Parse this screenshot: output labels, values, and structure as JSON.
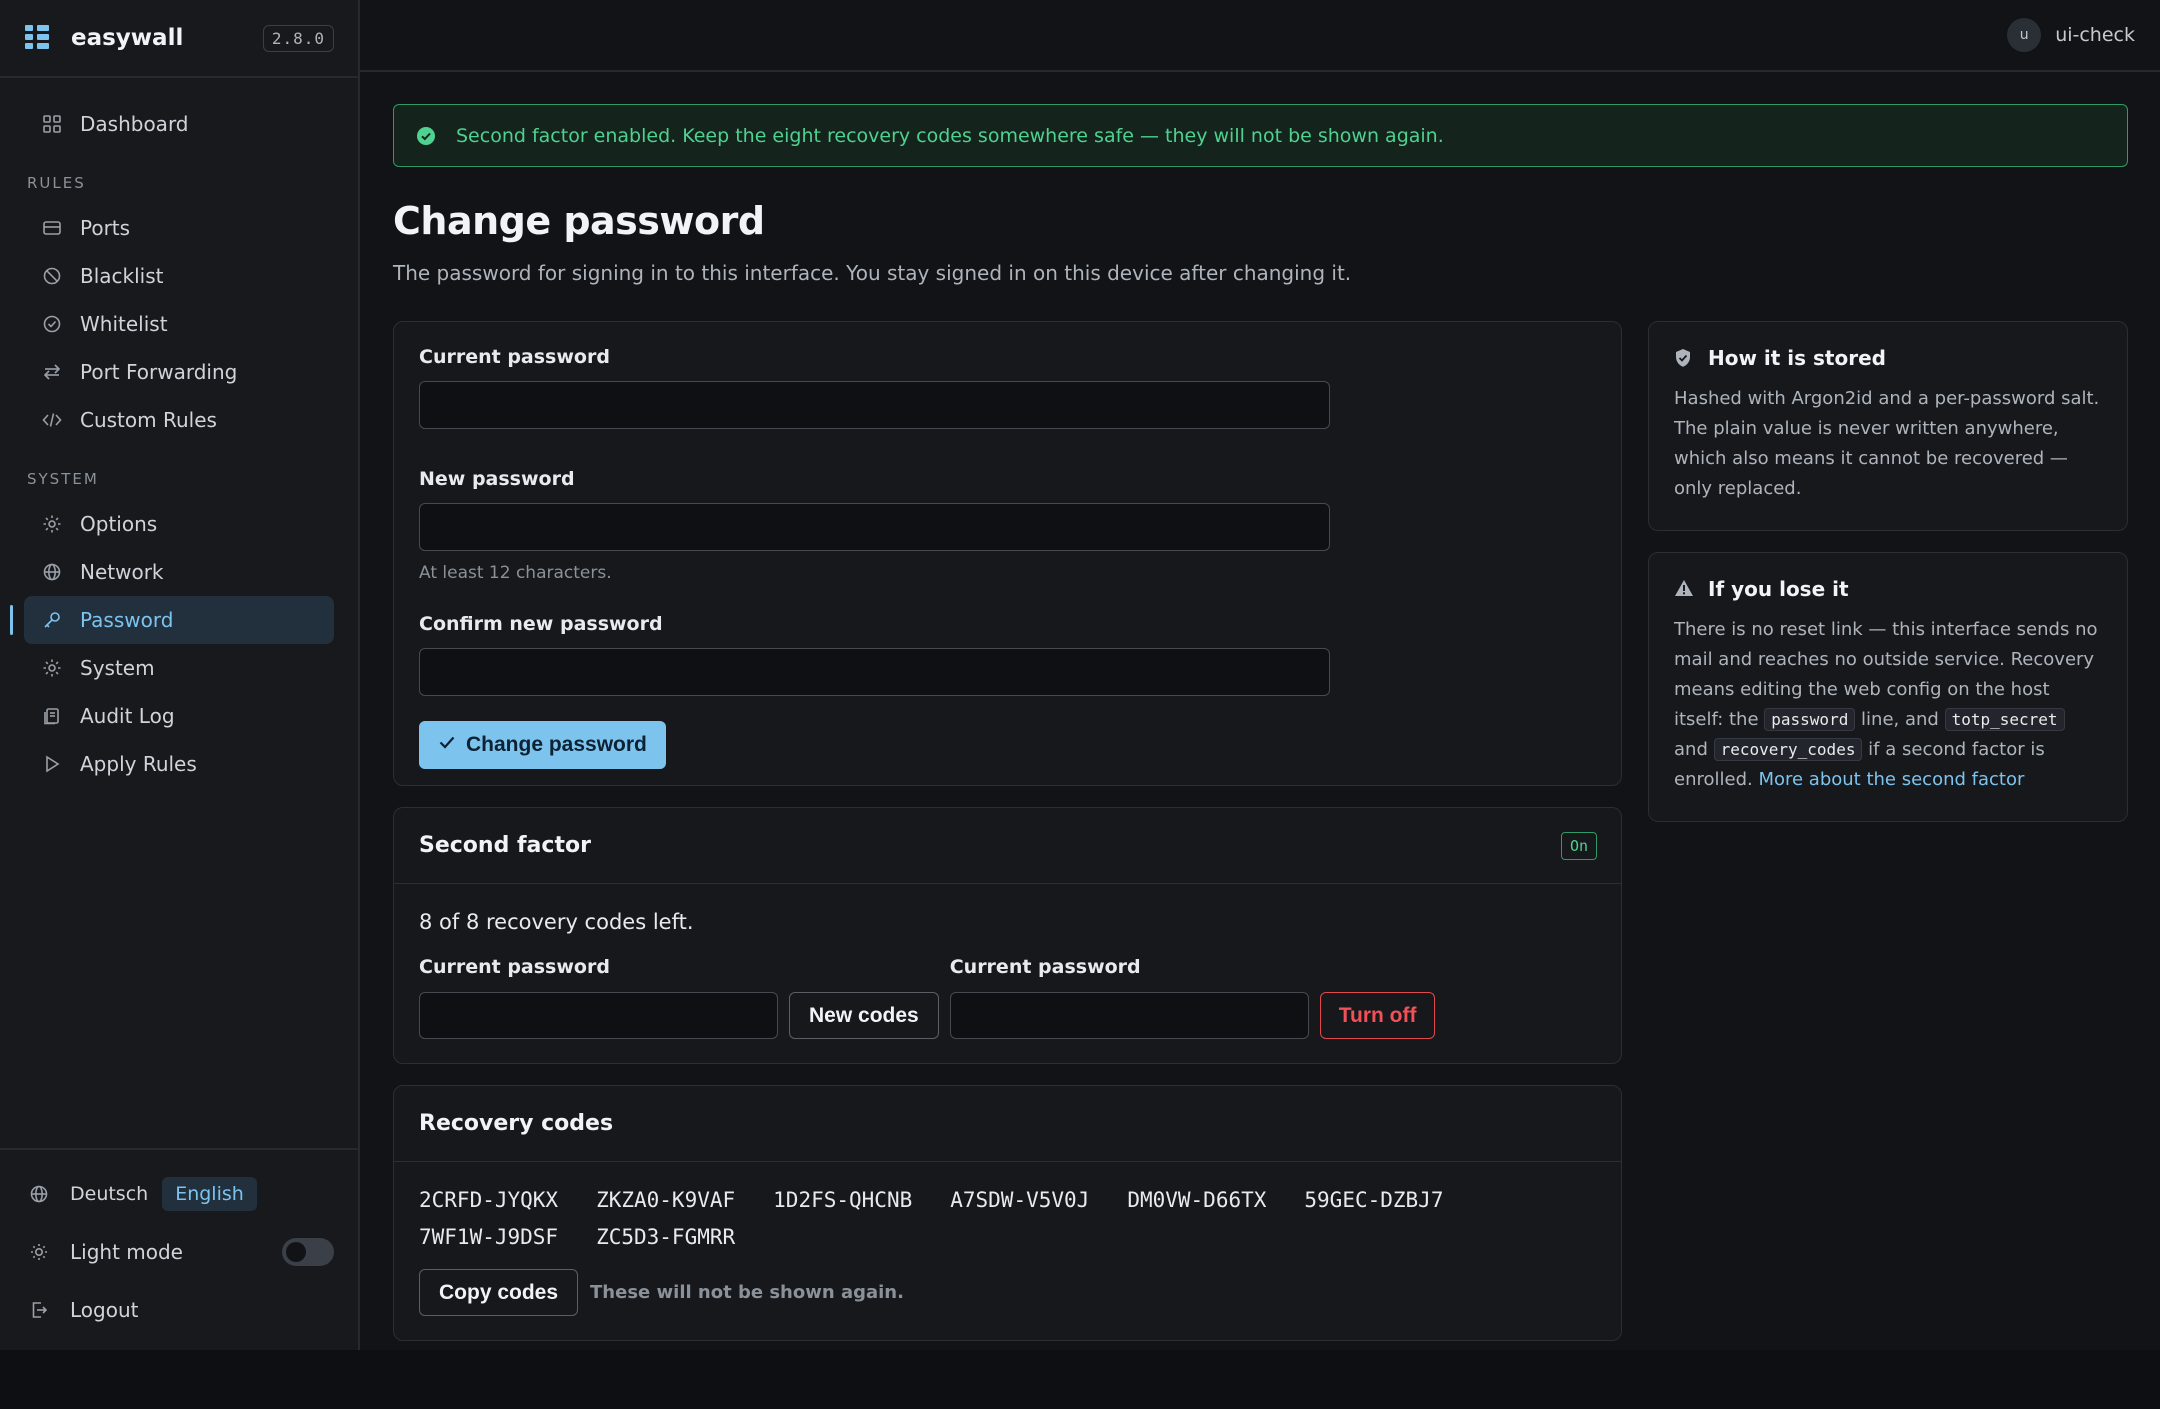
{
  "app": {
    "name": "easywall",
    "version": "2.8.0"
  },
  "sidebar": {
    "top_items": [
      {
        "label": "Dashboard",
        "icon": "grid-icon"
      }
    ],
    "sections": [
      {
        "title": "RULES",
        "items": [
          {
            "label": "Ports",
            "icon": "ports-icon"
          },
          {
            "label": "Blacklist",
            "icon": "ban-icon"
          },
          {
            "label": "Whitelist",
            "icon": "check-circle-icon"
          },
          {
            "label": "Port Forwarding",
            "icon": "arrows-icon"
          },
          {
            "label": "Custom Rules",
            "icon": "code-icon"
          }
        ]
      },
      {
        "title": "SYSTEM",
        "items": [
          {
            "label": "Options",
            "icon": "gear-icon"
          },
          {
            "label": "Network",
            "icon": "globe-icon"
          },
          {
            "label": "Password",
            "icon": "key-icon",
            "active": true
          },
          {
            "label": "System",
            "icon": "gear-icon"
          },
          {
            "label": "Audit Log",
            "icon": "log-icon"
          },
          {
            "label": "Apply Rules",
            "icon": "play-icon"
          }
        ]
      }
    ],
    "footer": {
      "languages": [
        "Deutsch",
        "English"
      ],
      "active_language": "English",
      "theme_label": "Light mode",
      "theme_on": false,
      "logout_label": "Logout"
    }
  },
  "topbar": {
    "avatar_initial": "u",
    "username": "ui-check"
  },
  "alert": {
    "text": "Second factor enabled. Keep the eight recovery codes somewhere safe — they will not be shown again.",
    "color": "#4fd18f"
  },
  "page": {
    "title": "Change password",
    "subtitle": "The password for signing in to this interface. You stay signed in on this device after changing it."
  },
  "password_form": {
    "current_label": "Current password",
    "current_value": "",
    "new_label": "New password",
    "new_value": "",
    "new_hint": "At least 12 characters.",
    "confirm_label": "Confirm new password",
    "confirm_value": "",
    "submit_label": "Change password"
  },
  "second_factor": {
    "title": "Second factor",
    "badge": "On",
    "status": "8 of 8 recovery codes left.",
    "regen_label": "Current password",
    "regen_button": "New codes",
    "disable_label": "Current password",
    "disable_button": "Turn off"
  },
  "recovery_codes": {
    "title": "Recovery codes",
    "codes": [
      "2CRFD-JYQKX",
      "ZKZA0-K9VAF",
      "1D2FS-QHCNB",
      "A7SDW-V5V0J",
      "DM0VW-D66TX",
      "59GEC-DZBJ7",
      "7WF1W-J9DSF",
      "ZC5D3-FGMRR"
    ],
    "copy_button": "Copy codes",
    "note": "These will not be shown again."
  },
  "info_stored": {
    "title": "How it is stored",
    "text": "Hashed with Argon2id and a per-password salt. The plain value is never written anywhere, which also means it cannot be recovered — only replaced."
  },
  "info_lose": {
    "title": "If you lose it",
    "text_1": "There is no reset link — this interface sends no mail and reaches no outside service. Recovery means editing the web config on the host itself: the ",
    "chip_1": "password",
    "text_2": " line, and ",
    "chip_2": "totp_secret",
    "text_3": " and ",
    "chip_3": "recovery_codes",
    "text_4": " if a second factor is enrolled. ",
    "link": "More about the second factor"
  },
  "colors": {
    "accent": "#7cc3ee",
    "success": "#4fd18f",
    "danger": "#f05258",
    "background": "#111317"
  }
}
